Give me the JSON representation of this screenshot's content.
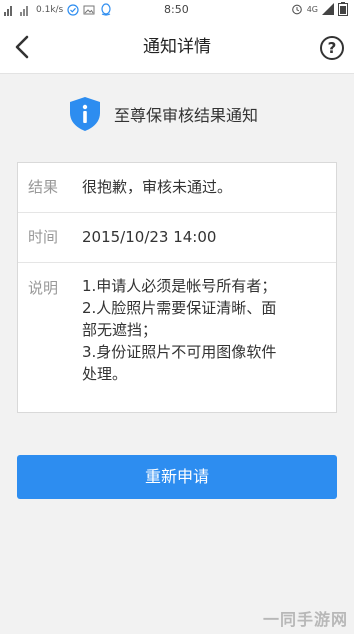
{
  "statusbar": {
    "speed": "0.1k/s",
    "time": "8:50",
    "network": "4G"
  },
  "appbar": {
    "title": "通知详情",
    "help_symbol": "?"
  },
  "notice": {
    "heading": "至尊保审核结果通知"
  },
  "details": {
    "result_label": "结果",
    "result_value": "很抱歉，审核未通过。",
    "time_label": "时间",
    "time_value": "2015/10/23 14:00",
    "note_label": "说明",
    "note_lines": [
      "1.申请人必须是帐号所有者；",
      "2.人脸照片需要保证清晰、面",
      "部无遮挡；",
      "3.身份证照片不可用图像软件",
      "处理。"
    ]
  },
  "actions": {
    "reapply_label": "重新申请"
  },
  "watermark": "一同手游网",
  "colors": {
    "primary": "#2d8df0",
    "background": "#f2f2f2"
  }
}
